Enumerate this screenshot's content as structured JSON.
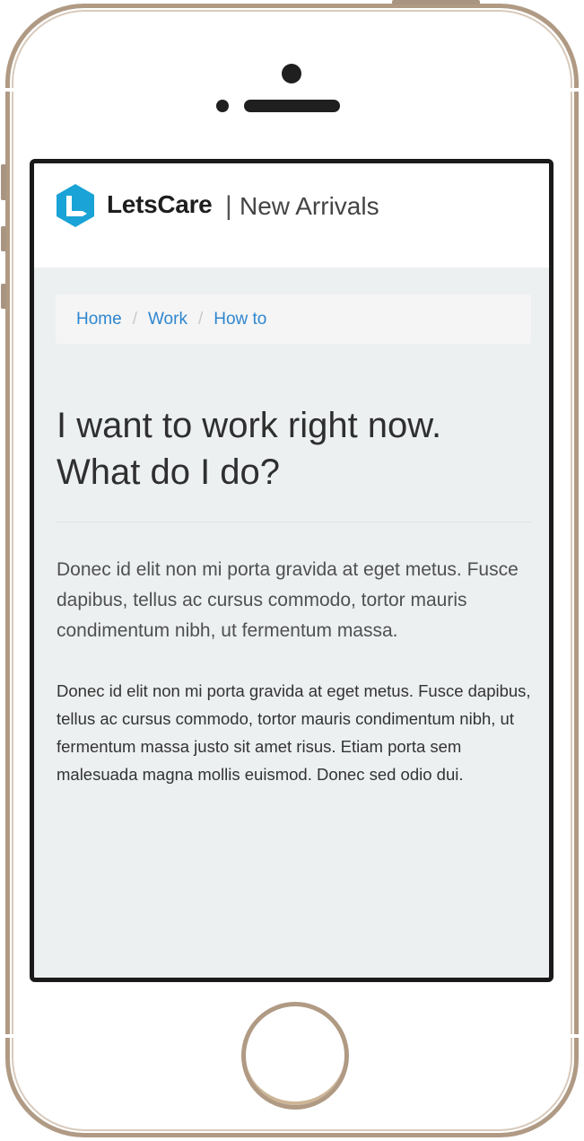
{
  "header": {
    "brand": "LetsCare",
    "separator": "|",
    "subtitle": "New Arrivals",
    "logo_icon": "letscare-logo-icon",
    "logo_color": "#1aa3d6"
  },
  "breadcrumb": {
    "items": [
      "Home",
      "Work",
      "How to"
    ],
    "separator": "/",
    "link_color": "#2f86cf"
  },
  "main": {
    "title_line1": "I want to work right now.",
    "title_line2": "What do I do?",
    "lead": "Donec id elit non mi porta gravida at eget metus. Fusce dapibus, tellus ac cursus commodo, tortor mauris condimentum nibh, ut fermentum massa.",
    "body": "Donec id elit non mi porta gravida at eget metus. Fusce dapibus, tellus ac cursus commodo, tortor mauris condimentum nibh, ut fermentum massa justo sit amet risus. Etiam porta sem malesuada magna mollis euismod. Donec sed odio dui."
  },
  "device": {
    "frame_color": "#b09a84",
    "screen_bg": "#edf0f1"
  }
}
